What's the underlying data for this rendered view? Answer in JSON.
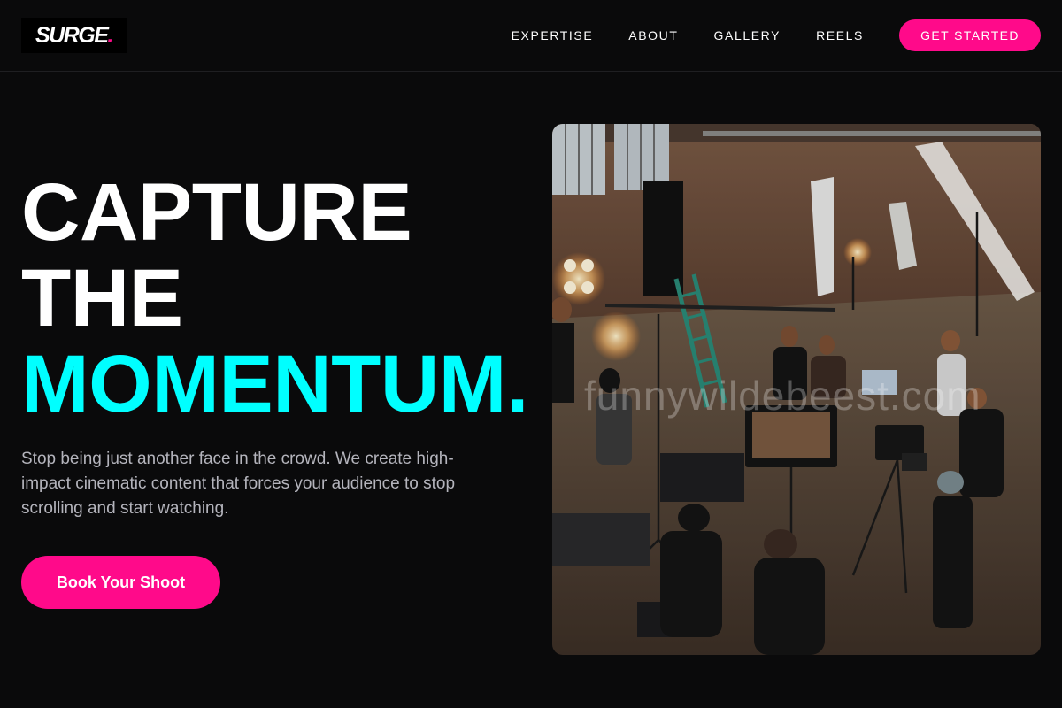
{
  "header": {
    "logo_text": "SURGE",
    "logo_dot": ".",
    "nav": [
      "EXPERTISE",
      "ABOUT",
      "GALLERY",
      "REELS"
    ],
    "cta_label": "GET STARTED"
  },
  "hero": {
    "heading_line1": "CAPTURE",
    "heading_line2": "THE",
    "heading_line3": "MOMENTUM.",
    "subtext": "Stop being just another face in the crowd. We create high-impact cinematic content that forces your audience to stop scrolling and start watching.",
    "book_label": "Book Your Shoot",
    "watermark": "funnywildebeest.com",
    "image_icon": "film-set-photo"
  },
  "colors": {
    "accent_pink": "#ff0a8a",
    "accent_cyan": "#00ffff",
    "background": "#0a0a0b"
  }
}
